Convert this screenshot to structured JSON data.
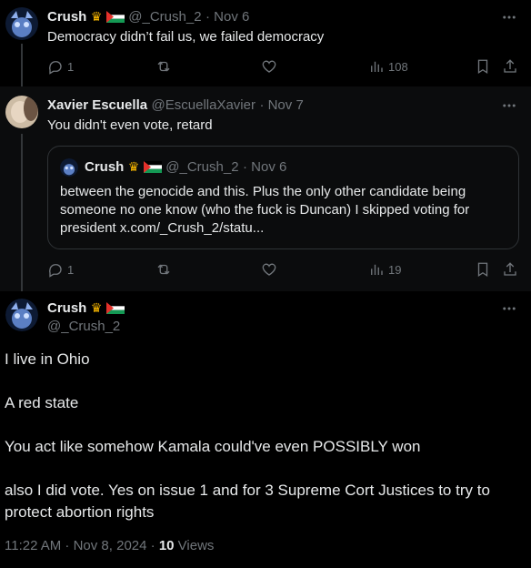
{
  "tweet1": {
    "name": "Crush",
    "handle": "@_Crush_2",
    "date": "· Nov 6",
    "text": "Democracy didn’t fail us, we failed democracy",
    "replies": "1",
    "views": "108"
  },
  "tweet2": {
    "name": "Xavier Escuella",
    "handle": "@EscuellaXavier",
    "date": "· Nov 7",
    "text": "You didn't even vote, retard",
    "replies": "1",
    "views": "19",
    "quote": {
      "name": "Crush",
      "handle": "@_Crush_2",
      "date": "· Nov 6",
      "text": "between the genocide and this. Plus the only other candidate being someone no one know (who the fuck is Duncan) I skipped voting for president x.com/_Crush_2/statu..."
    }
  },
  "main": {
    "name": "Crush",
    "handle": "@_Crush_2",
    "paragraphs": [
      "I live in Ohio",
      "A red state",
      "You act like somehow Kamala could've even POSSIBLY won",
      "also I did vote. Yes on issue 1 and for 3 Supreme Cort Justices to try to protect abortion rights"
    ],
    "timestamp": "11:22 AM · Nov 8, 2024 · ",
    "views_count": "10",
    "views_label": " Views"
  },
  "icons": [
    "reply-icon",
    "retweet-icon",
    "like-icon",
    "views-icon",
    "bookmark-icon",
    "share-icon",
    "more-icon",
    "crown-emoji",
    "palestine-flag"
  ],
  "colors": {
    "background": "#000000",
    "text": "#e7e9ea",
    "muted": "#71767b",
    "border": "#2f3336"
  }
}
